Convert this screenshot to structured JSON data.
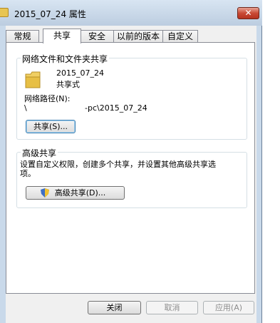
{
  "title": "2015_07_24 属性",
  "close_glyph": "✕",
  "tabs": [
    "常规",
    "共享",
    "安全",
    "以前的版本",
    "自定义"
  ],
  "network_share": {
    "group_title": "网络文件和文件夹共享",
    "folder_name": "2015_07_24",
    "share_state": "共享式",
    "path_label": "网络路径(N):",
    "path_prefix": "\\",
    "path_value": "-pc\\2015_07_24",
    "share_button": "共享(S)..."
  },
  "advanced_share": {
    "group_title": "高级共享",
    "description_line1": "设置自定义权限，创建多个共享，并设置其他高级共享选",
    "description_line2": "项。",
    "button": "高级共享(D)..."
  },
  "footer": {
    "close": "关闭",
    "cancel": "取消",
    "apply": "应用(A)"
  }
}
